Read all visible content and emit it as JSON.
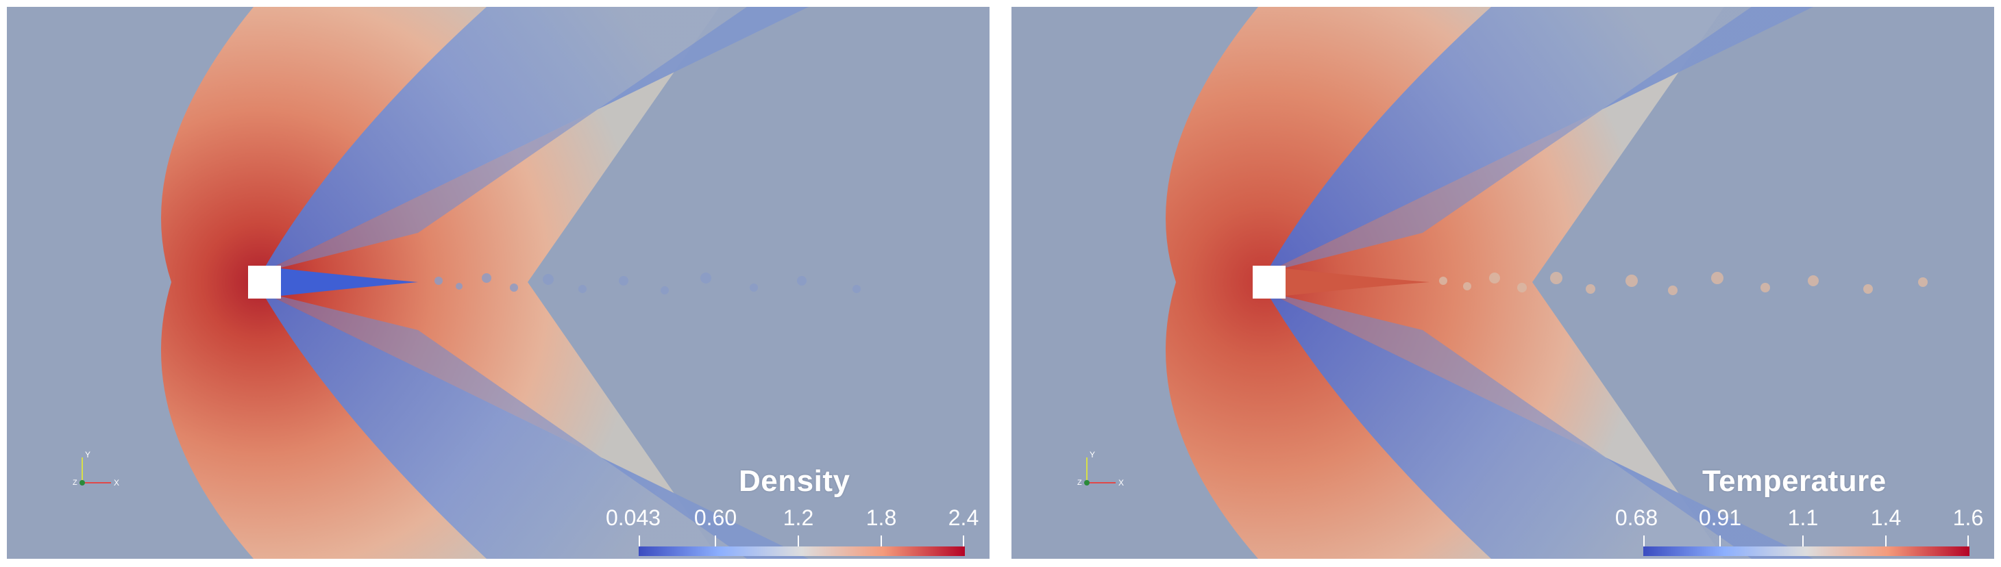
{
  "panels": [
    {
      "variable": "Density",
      "colorbar": {
        "ticks": [
          "0.043",
          "0.60",
          "1.2",
          "1.8",
          "2.4"
        ],
        "colors": [
          "#3b4cc0",
          "#8db0fe",
          "#dddddd",
          "#f49a7b",
          "#b40426"
        ]
      }
    },
    {
      "variable": "Temperature",
      "colorbar": {
        "ticks": [
          "0.68",
          "0.91",
          "1.1",
          "1.4",
          "1.6"
        ],
        "colors": [
          "#3b4cc0",
          "#8db0fe",
          "#dddddd",
          "#f49a7b",
          "#b40426"
        ]
      }
    }
  ],
  "orientation_axes": {
    "labels": [
      "Y",
      "Z",
      "X"
    ]
  },
  "colors": {
    "background": "#98a4b9",
    "freestream": "#95a3bd",
    "shock_red": "#c0443a",
    "expansion_blue": "#6f8dd6",
    "body": "#ffffff"
  }
}
